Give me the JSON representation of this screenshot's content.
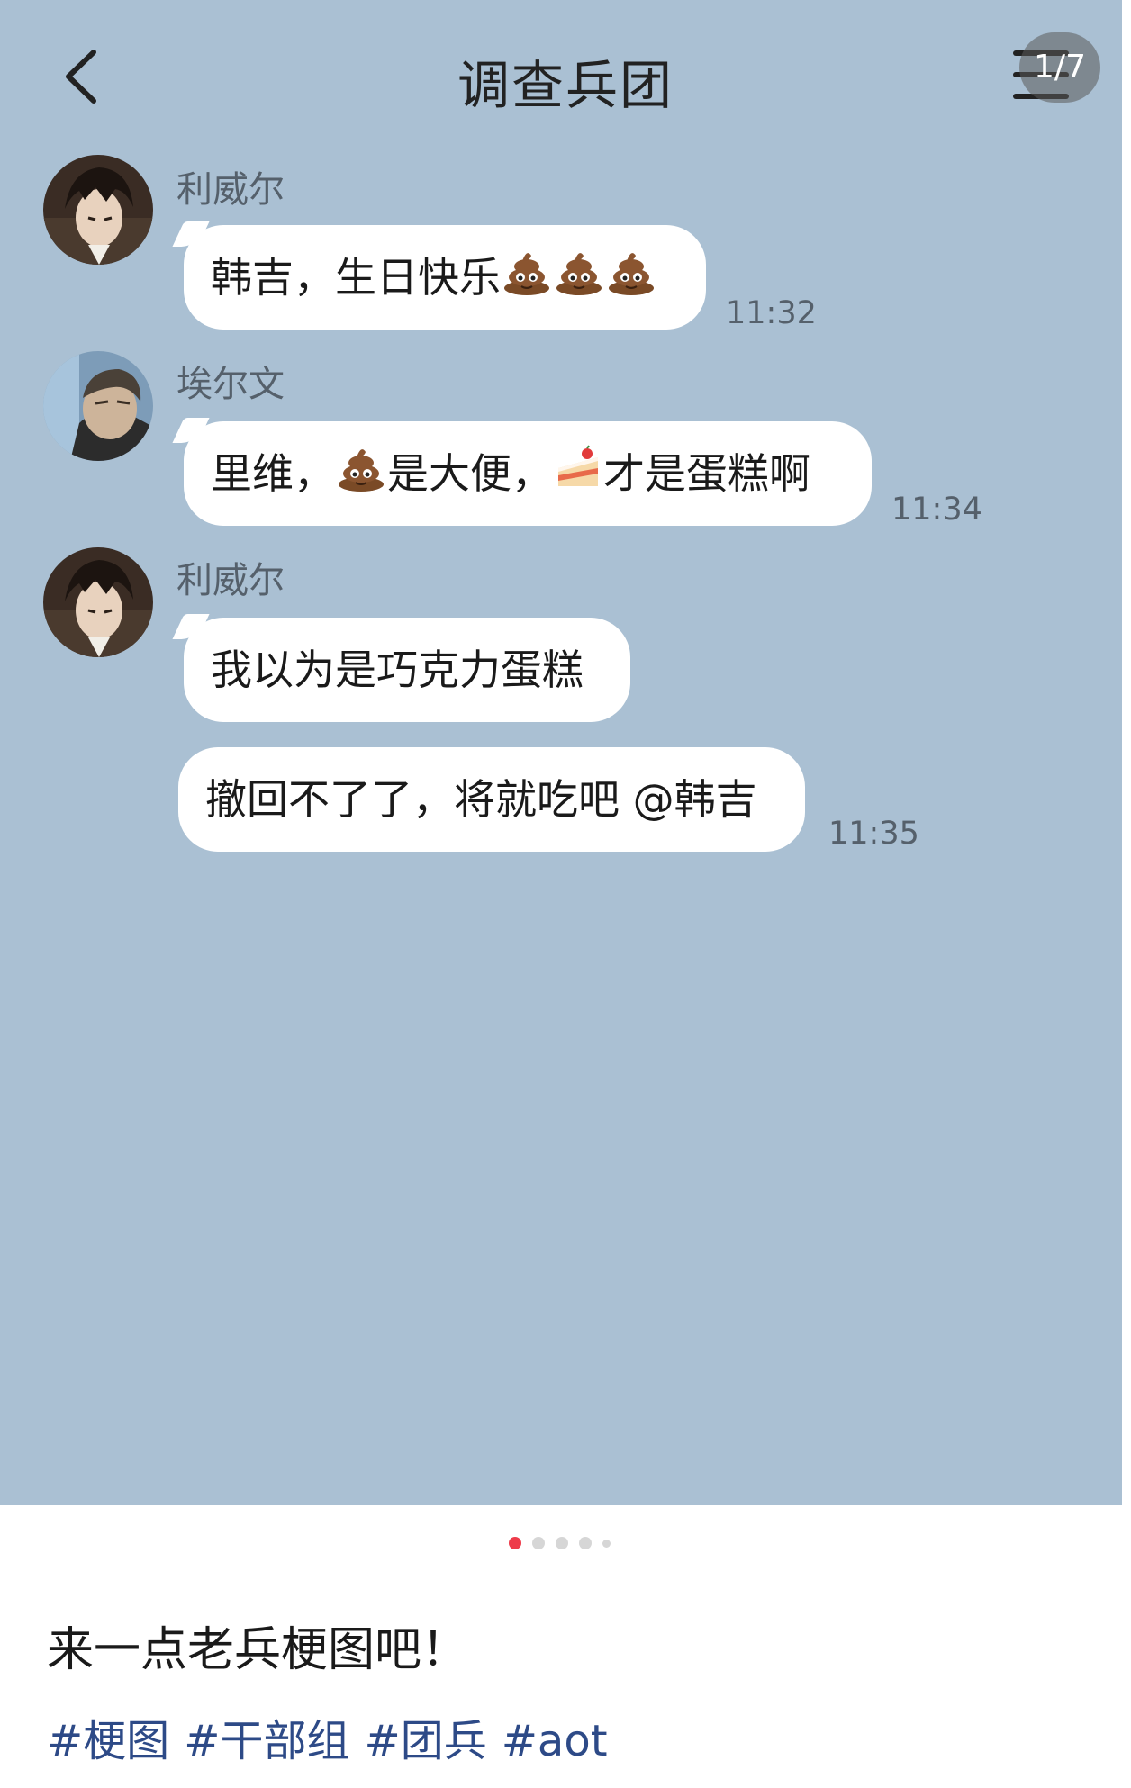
{
  "header": {
    "title": "调查兵团",
    "page_counter": "1/7"
  },
  "messages": [
    {
      "sender": "利威尔",
      "text": "韩吉，生日快乐",
      "trailing_emoji": [
        "poop",
        "poop",
        "poop"
      ],
      "time": "11:32"
    },
    {
      "sender": "埃尔文",
      "parts": [
        "里维，",
        "是大便，",
        "才是蛋糕啊"
      ],
      "time": "11:34"
    },
    {
      "sender": "利威尔",
      "text": "我以为是巧克力蛋糕"
    },
    {
      "text": "撤回不了了，将就吃吧 @韩吉",
      "time": "11:35"
    }
  ],
  "colors": {
    "chat_background": "#aac0d3",
    "bubble": "#ffffff",
    "active_dot": "#ee3b4a",
    "tag": "#2d4a87"
  },
  "carousel": {
    "total_dots": 5,
    "active_index": 0
  },
  "post": {
    "title": "来一点老兵梗图吧！",
    "tags": [
      "#梗图",
      "#干部组",
      "#团兵",
      "#aot"
    ]
  }
}
